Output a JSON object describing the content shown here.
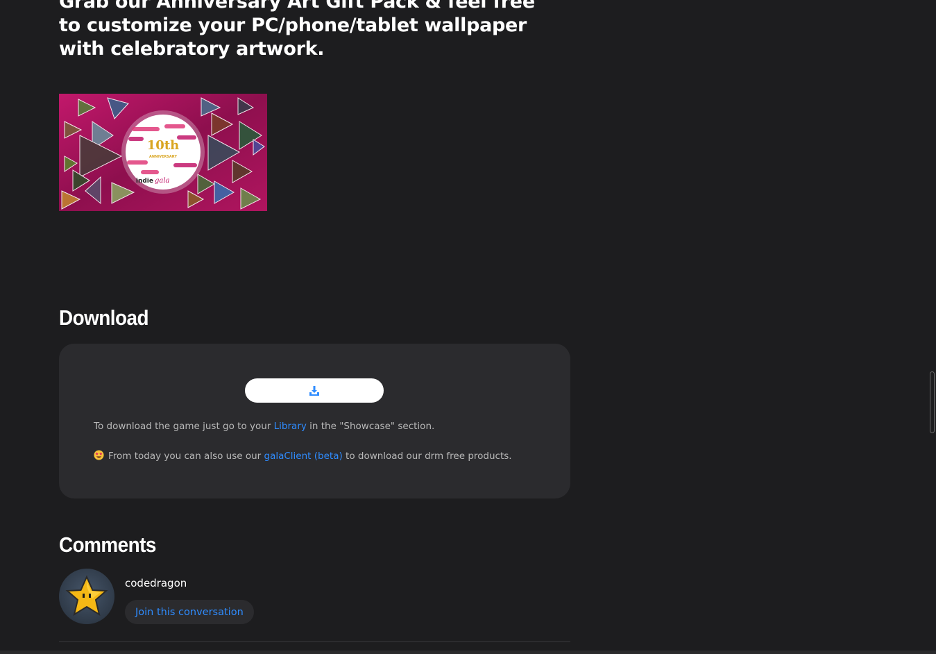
{
  "promo": {
    "text": "Grab our Anniversary Art Gift Pack & feel free to customize your PC/phone/tablet wallpaper with celebratory artwork."
  },
  "banner": {
    "headline": "10th",
    "subtitle": "ANNIVERSARY",
    "brand_prefix": "indie",
    "brand_suffix": "gala"
  },
  "download": {
    "heading": "Download",
    "button_icon": "download-icon",
    "line1": {
      "before": "To download the game just go to your ",
      "link": "Library",
      "after": " in the \"Showcase\" section."
    },
    "line2": {
      "emoji": "star-struck-emoji",
      "before": "From today you can also use our ",
      "link": "galaClient (beta)",
      "after": " to download our drm free products."
    }
  },
  "comments": {
    "heading": "Comments",
    "user": {
      "avatar_icon": "star-avatar",
      "name": "codedragon"
    },
    "join_label": "Join this conversation"
  },
  "colors": {
    "background": "#1d1d1f",
    "card": "#2b2b2e",
    "link": "#2f8cff",
    "heading": "#ffffff"
  }
}
